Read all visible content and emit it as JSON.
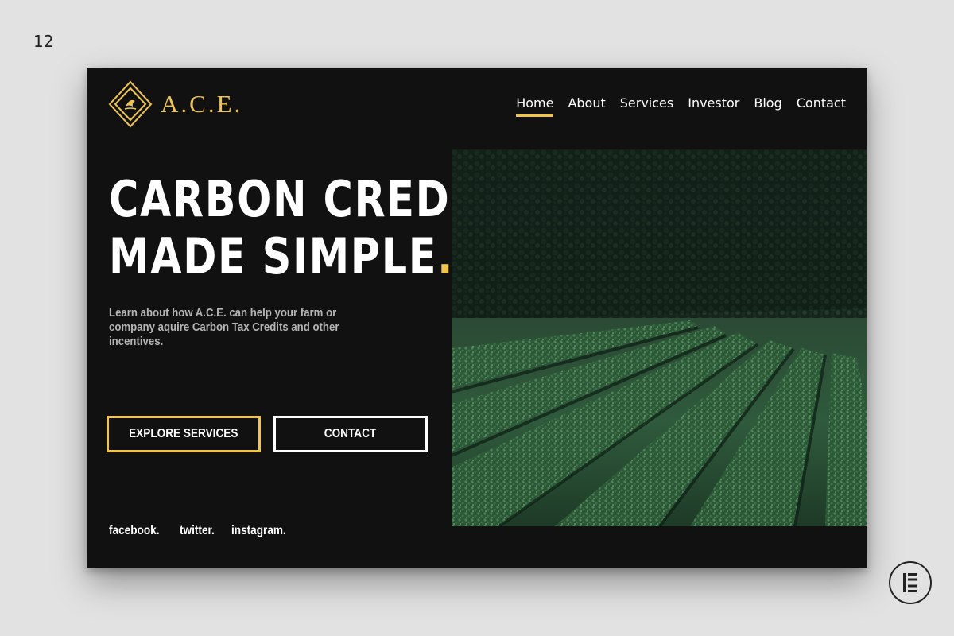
{
  "slide": {
    "number": "12"
  },
  "brand": {
    "name": "A.C.E.",
    "accent_color": "#f0c64a",
    "background_color": "#111111"
  },
  "nav": {
    "items": [
      {
        "label": "Home",
        "active": true
      },
      {
        "label": "About",
        "active": false
      },
      {
        "label": "Services",
        "active": false
      },
      {
        "label": "Investor",
        "active": false
      },
      {
        "label": "Blog",
        "active": false
      },
      {
        "label": "Contact",
        "active": false
      }
    ]
  },
  "hero": {
    "title_line1": "CARBON CREDITS",
    "title_line2": "MADE SIMPLE",
    "title_dot": ".",
    "subtitle": "Learn about how A.C.E. can help your farm or company aquire Carbon Tax Credits and other incentives.",
    "primary_button": "EXPLORE SERVICES",
    "secondary_button": "CONTACT",
    "image": "tea-field-photo"
  },
  "social": [
    "facebook.",
    "twitter.",
    "instagram."
  ],
  "badge": {
    "icon": "elementor-logo-icon"
  }
}
